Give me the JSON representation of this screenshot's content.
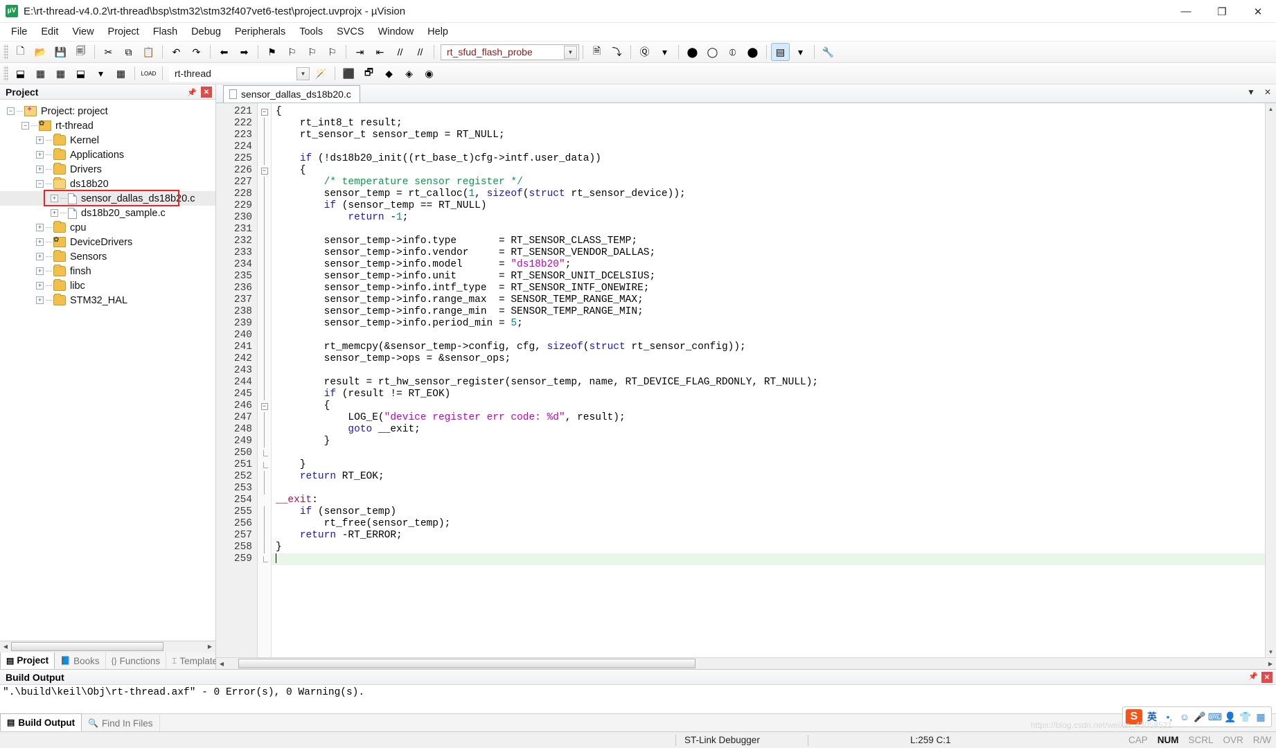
{
  "window": {
    "title": "E:\\rt-thread-v4.0.2\\rt-thread\\bsp\\stm32\\stm32f407vet6-test\\project.uvprojx - µVision",
    "app_icon": "uvision-icon",
    "minimize": "—",
    "maximize": "❐",
    "close": "✕"
  },
  "menubar": [
    {
      "label": "File"
    },
    {
      "label": "Edit"
    },
    {
      "label": "View"
    },
    {
      "label": "Project"
    },
    {
      "label": "Flash"
    },
    {
      "label": "Debug"
    },
    {
      "label": "Peripherals"
    },
    {
      "label": "Tools"
    },
    {
      "label": "SVCS"
    },
    {
      "label": "Window"
    },
    {
      "label": "Help"
    }
  ],
  "toolbar_main": {
    "buttons": [
      {
        "name": "new-file-button",
        "glyph": "🗋"
      },
      {
        "name": "open-file-button",
        "glyph": "📂"
      },
      {
        "name": "save-button",
        "glyph": "💾"
      },
      {
        "name": "save-all-button",
        "glyph": "🗐"
      },
      {
        "name": "cut-button",
        "glyph": "✂"
      },
      {
        "name": "copy-button",
        "glyph": "⧉"
      },
      {
        "name": "paste-button",
        "glyph": "📋"
      },
      {
        "name": "undo-button",
        "glyph": "↶"
      },
      {
        "name": "redo-button",
        "glyph": "↷"
      },
      {
        "name": "navigate-back-button",
        "glyph": "⬅"
      },
      {
        "name": "navigate-forward-button",
        "glyph": "➡"
      },
      {
        "name": "bookmark-toggle-button",
        "glyph": "⚑"
      },
      {
        "name": "bookmark-prev-button",
        "glyph": "⚐"
      },
      {
        "name": "bookmark-next-button",
        "glyph": "⚐"
      },
      {
        "name": "bookmark-clear-button",
        "glyph": "⚐"
      },
      {
        "name": "indent-button",
        "glyph": "⇥"
      },
      {
        "name": "outdent-button",
        "glyph": "⇤"
      },
      {
        "name": "comment-button",
        "glyph": "//"
      },
      {
        "name": "uncomment-button",
        "glyph": "//"
      }
    ],
    "find_combo": {
      "value": "rt_sfud_flash_probe",
      "arrow": "▼"
    },
    "after_find": [
      {
        "name": "find-in-files-button",
        "glyph": "🗎"
      },
      {
        "name": "goto-definition-button",
        "glyph": "⤵"
      },
      {
        "name": "debug-start-button",
        "glyph": "Ⓠ"
      },
      {
        "name": "debug-dropdown-arrow",
        "glyph": "▾"
      },
      {
        "name": "insert-breakpoint-button",
        "glyph": "⬤"
      },
      {
        "name": "disable-breakpoint-button",
        "glyph": "◯"
      },
      {
        "name": "disable-all-breakpoints-button",
        "glyph": "⦶"
      },
      {
        "name": "kill-all-breakpoints-button",
        "glyph": "⬤"
      },
      {
        "name": "project-window-toggle-button",
        "glyph": "▤"
      },
      {
        "name": "window-dropdown-arrow",
        "glyph": "▾"
      },
      {
        "name": "configure-button",
        "glyph": "🔧"
      }
    ]
  },
  "toolbar_build": {
    "buttons": [
      {
        "name": "translate-file-button",
        "glyph": "⬓"
      },
      {
        "name": "build-target-button",
        "glyph": "▦"
      },
      {
        "name": "rebuild-all-button",
        "glyph": "▦"
      },
      {
        "name": "batch-build-button",
        "glyph": "⬓"
      },
      {
        "name": "batch-build-arrow",
        "glyph": "▾"
      },
      {
        "name": "stop-build-button",
        "glyph": "▦"
      },
      {
        "name": "download-button",
        "glyph": "LOAD"
      }
    ],
    "target_combo": {
      "value": "rt-thread",
      "arrow": "▼"
    },
    "after_target": [
      {
        "name": "target-options-button",
        "glyph": "🪄"
      },
      {
        "name": "manage-components-button",
        "glyph": "⬛"
      },
      {
        "name": "multi-project-button",
        "glyph": "🗗"
      },
      {
        "name": "pack-installer-button",
        "glyph": "◆"
      },
      {
        "name": "manage-run-time-button",
        "glyph": "◈"
      },
      {
        "name": "svcs-button",
        "glyph": "◉"
      }
    ]
  },
  "project_panel": {
    "title": "Project",
    "pin_icon": "pin-icon",
    "close_icon": "close-icon",
    "tree": [
      {
        "label": "Project: project",
        "depth": 0,
        "expander": "−",
        "icon": "proj",
        "highlight": false
      },
      {
        "label": "rt-thread",
        "depth": 1,
        "expander": "−",
        "icon": "rt",
        "highlight": false
      },
      {
        "label": "Kernel",
        "depth": 2,
        "expander": "+",
        "icon": "folder",
        "highlight": false
      },
      {
        "label": "Applications",
        "depth": 2,
        "expander": "+",
        "icon": "folder",
        "highlight": false
      },
      {
        "label": "Drivers",
        "depth": 2,
        "expander": "+",
        "icon": "folder",
        "highlight": false
      },
      {
        "label": "ds18b20",
        "depth": 2,
        "expander": "−",
        "icon": "folder-open",
        "highlight": false
      },
      {
        "label": "sensor_dallas_ds18b20.c",
        "depth": 3,
        "expander": "+",
        "icon": "file",
        "highlight": true
      },
      {
        "label": "ds18b20_sample.c",
        "depth": 3,
        "expander": "+",
        "icon": "file",
        "highlight": false
      },
      {
        "label": "cpu",
        "depth": 2,
        "expander": "+",
        "icon": "folder",
        "highlight": false
      },
      {
        "label": "DeviceDrivers",
        "depth": 2,
        "expander": "+",
        "icon": "rt",
        "highlight": false
      },
      {
        "label": "Sensors",
        "depth": 2,
        "expander": "+",
        "icon": "folder",
        "highlight": false
      },
      {
        "label": "finsh",
        "depth": 2,
        "expander": "+",
        "icon": "folder",
        "highlight": false
      },
      {
        "label": "libc",
        "depth": 2,
        "expander": "+",
        "icon": "folder",
        "highlight": false
      },
      {
        "label": "STM32_HAL",
        "depth": 2,
        "expander": "+",
        "icon": "folder",
        "highlight": false
      }
    ],
    "tabs": [
      {
        "label": "Project",
        "icon": "project-icon",
        "selected": true
      },
      {
        "label": "Books",
        "icon": "books-icon",
        "selected": false
      },
      {
        "label": "Functions",
        "icon": "functions-icon",
        "selected": false
      },
      {
        "label": "Templates",
        "icon": "templates-icon",
        "selected": false
      }
    ],
    "scroll_left_arrow": "◀",
    "scroll_right_arrow": "▶"
  },
  "editor": {
    "tab_label": "sensor_dallas_ds18b20.c",
    "tab_icon": "c-file-icon",
    "dropdown_icon": "▼",
    "close_icon": "✕",
    "first_line": 221,
    "lines": [
      {
        "n": 221,
        "fold": "minus",
        "tokens": [
          {
            "t": "{",
            "c": ""
          }
        ]
      },
      {
        "n": 222,
        "fold": "bar",
        "tokens": [
          {
            "t": "    rt_int8_t result;",
            "c": ""
          }
        ]
      },
      {
        "n": 223,
        "fold": "bar",
        "tokens": [
          {
            "t": "    rt_sensor_t sensor_temp = RT_NULL;",
            "c": ""
          }
        ]
      },
      {
        "n": 224,
        "fold": "bar",
        "tokens": [
          {
            "t": "",
            "c": ""
          }
        ]
      },
      {
        "n": 225,
        "fold": "bar",
        "tokens": [
          {
            "t": "    ",
            "c": ""
          },
          {
            "t": "if",
            "c": "kw"
          },
          {
            "t": " (!ds18b20_init((rt_base_t)cfg->intf.user_data))",
            "c": ""
          }
        ]
      },
      {
        "n": 226,
        "fold": "minus",
        "tokens": [
          {
            "t": "    {",
            "c": ""
          }
        ]
      },
      {
        "n": 227,
        "fold": "bar",
        "tokens": [
          {
            "t": "        ",
            "c": ""
          },
          {
            "t": "/* temperature sensor register */",
            "c": "cmt"
          }
        ]
      },
      {
        "n": 228,
        "fold": "bar",
        "tokens": [
          {
            "t": "        sensor_temp = rt_calloc(",
            "c": ""
          },
          {
            "t": "1",
            "c": "num"
          },
          {
            "t": ", ",
            "c": ""
          },
          {
            "t": "sizeof",
            "c": "kw"
          },
          {
            "t": "(",
            "c": ""
          },
          {
            "t": "struct",
            "c": "kw"
          },
          {
            "t": " rt_sensor_device));",
            "c": ""
          }
        ]
      },
      {
        "n": 229,
        "fold": "bar",
        "tokens": [
          {
            "t": "        ",
            "c": ""
          },
          {
            "t": "if",
            "c": "kw"
          },
          {
            "t": " (sensor_temp == RT_NULL)",
            "c": ""
          }
        ]
      },
      {
        "n": 230,
        "fold": "bar",
        "tokens": [
          {
            "t": "            ",
            "c": ""
          },
          {
            "t": "return",
            "c": "kw"
          },
          {
            "t": " -",
            "c": ""
          },
          {
            "t": "1",
            "c": "num"
          },
          {
            "t": ";",
            "c": ""
          }
        ]
      },
      {
        "n": 231,
        "fold": "bar",
        "tokens": [
          {
            "t": "",
            "c": ""
          }
        ]
      },
      {
        "n": 232,
        "fold": "bar",
        "tokens": [
          {
            "t": "        sensor_temp->info.type       = RT_SENSOR_CLASS_TEMP;",
            "c": ""
          }
        ]
      },
      {
        "n": 233,
        "fold": "bar",
        "tokens": [
          {
            "t": "        sensor_temp->info.vendor     = RT_SENSOR_VENDOR_DALLAS;",
            "c": ""
          }
        ]
      },
      {
        "n": 234,
        "fold": "bar",
        "tokens": [
          {
            "t": "        sensor_temp->info.model      = ",
            "c": ""
          },
          {
            "t": "\"ds18b20\"",
            "c": "str"
          },
          {
            "t": ";",
            "c": ""
          }
        ]
      },
      {
        "n": 235,
        "fold": "bar",
        "tokens": [
          {
            "t": "        sensor_temp->info.unit       = RT_SENSOR_UNIT_DCELSIUS;",
            "c": ""
          }
        ]
      },
      {
        "n": 236,
        "fold": "bar",
        "tokens": [
          {
            "t": "        sensor_temp->info.intf_type  = RT_SENSOR_INTF_ONEWIRE;",
            "c": ""
          }
        ]
      },
      {
        "n": 237,
        "fold": "bar",
        "tokens": [
          {
            "t": "        sensor_temp->info.range_max  = SENSOR_TEMP_RANGE_MAX;",
            "c": ""
          }
        ]
      },
      {
        "n": 238,
        "fold": "bar",
        "tokens": [
          {
            "t": "        sensor_temp->info.range_min  = SENSOR_TEMP_RANGE_MIN;",
            "c": ""
          }
        ]
      },
      {
        "n": 239,
        "fold": "bar",
        "tokens": [
          {
            "t": "        sensor_temp->info.period_min = ",
            "c": ""
          },
          {
            "t": "5",
            "c": "num"
          },
          {
            "t": ";",
            "c": ""
          }
        ]
      },
      {
        "n": 240,
        "fold": "bar",
        "tokens": [
          {
            "t": "",
            "c": ""
          }
        ]
      },
      {
        "n": 241,
        "fold": "bar",
        "tokens": [
          {
            "t": "        rt_memcpy(&sensor_temp->config, cfg, ",
            "c": ""
          },
          {
            "t": "sizeof",
            "c": "kw"
          },
          {
            "t": "(",
            "c": ""
          },
          {
            "t": "struct",
            "c": "kw"
          },
          {
            "t": " rt_sensor_config));",
            "c": ""
          }
        ]
      },
      {
        "n": 242,
        "fold": "bar",
        "tokens": [
          {
            "t": "        sensor_temp->ops = &sensor_ops;",
            "c": ""
          }
        ]
      },
      {
        "n": 243,
        "fold": "bar",
        "tokens": [
          {
            "t": "",
            "c": ""
          }
        ]
      },
      {
        "n": 244,
        "fold": "bar",
        "tokens": [
          {
            "t": "        result = rt_hw_sensor_register(sensor_temp, name, RT_DEVICE_FLAG_RDONLY, RT_NULL);",
            "c": ""
          }
        ]
      },
      {
        "n": 245,
        "fold": "bar",
        "tokens": [
          {
            "t": "        ",
            "c": ""
          },
          {
            "t": "if",
            "c": "kw"
          },
          {
            "t": " (result != RT_EOK)",
            "c": ""
          }
        ]
      },
      {
        "n": 246,
        "fold": "minus",
        "tokens": [
          {
            "t": "        {",
            "c": ""
          }
        ]
      },
      {
        "n": 247,
        "fold": "bar",
        "tokens": [
          {
            "t": "            LOG_E(",
            "c": ""
          },
          {
            "t": "\"device register err code: %d\"",
            "c": "str"
          },
          {
            "t": ", result);",
            "c": ""
          }
        ]
      },
      {
        "n": 248,
        "fold": "bar",
        "tokens": [
          {
            "t": "            ",
            "c": ""
          },
          {
            "t": "goto",
            "c": "kw"
          },
          {
            "t": " __exit;",
            "c": ""
          }
        ]
      },
      {
        "n": 249,
        "fold": "bar",
        "tokens": [
          {
            "t": "        }",
            "c": ""
          }
        ]
      },
      {
        "n": 250,
        "fold": "end",
        "tokens": [
          {
            "t": "",
            "c": ""
          }
        ]
      },
      {
        "n": 251,
        "fold": "end",
        "tokens": [
          {
            "t": "    }",
            "c": ""
          }
        ]
      },
      {
        "n": 252,
        "fold": "bar",
        "tokens": [
          {
            "t": "    ",
            "c": ""
          },
          {
            "t": "return",
            "c": "kw"
          },
          {
            "t": " RT_EOK;",
            "c": ""
          }
        ]
      },
      {
        "n": 253,
        "fold": "bar",
        "tokens": [
          {
            "t": "",
            "c": ""
          }
        ]
      },
      {
        "n": 254,
        "fold": "none",
        "tokens": [
          {
            "t": "__exit",
            "c": "lbl"
          },
          {
            "t": ":",
            "c": ""
          }
        ]
      },
      {
        "n": 255,
        "fold": "bar",
        "tokens": [
          {
            "t": "    ",
            "c": ""
          },
          {
            "t": "if",
            "c": "kw"
          },
          {
            "t": " (sensor_temp)",
            "c": ""
          }
        ]
      },
      {
        "n": 256,
        "fold": "bar",
        "tokens": [
          {
            "t": "        rt_free(sensor_temp);",
            "c": ""
          }
        ]
      },
      {
        "n": 257,
        "fold": "bar",
        "tokens": [
          {
            "t": "    ",
            "c": ""
          },
          {
            "t": "return",
            "c": "kw"
          },
          {
            "t": " -RT_ERROR;",
            "c": ""
          }
        ]
      },
      {
        "n": 258,
        "fold": "bar",
        "tokens": [
          {
            "t": "}",
            "c": ""
          }
        ]
      },
      {
        "n": 259,
        "fold": "end",
        "tokens": [
          {
            "t": "",
            "c": ""
          }
        ],
        "current": true
      }
    ],
    "scroll_up_arrow": "▲",
    "scroll_down_arrow": "▼",
    "scroll_left_arrow": "◀",
    "scroll_right_arrow": "▶"
  },
  "build_output": {
    "title": "Build Output",
    "pin_icon": "pin-icon",
    "close_icon": "close-icon",
    "text": "\".\\build\\keil\\Obj\\rt-thread.axf\" - 0 Error(s), 0 Warning(s).",
    "tabs": [
      {
        "label": "Build Output",
        "icon": "build-output-icon",
        "selected": true
      },
      {
        "label": "Find In Files",
        "icon": "find-in-files-icon",
        "selected": false
      }
    ]
  },
  "ime": {
    "logo": "S",
    "mode": "英",
    "items": [
      {
        "name": "punctuation-icon",
        "glyph": "•,"
      },
      {
        "name": "emoji-icon",
        "glyph": "☺"
      },
      {
        "name": "microphone-icon",
        "glyph": "🎤"
      },
      {
        "name": "keyboard-icon",
        "glyph": "⌨"
      },
      {
        "name": "user-icon",
        "glyph": "👤"
      },
      {
        "name": "skin-icon",
        "glyph": "👕"
      },
      {
        "name": "toolbox-icon",
        "glyph": "▦"
      }
    ]
  },
  "statusbar": {
    "debugger": "ST-Link Debugger",
    "position": "L:259 C:1",
    "flags": [
      {
        "label": "CAP",
        "on": false
      },
      {
        "label": "NUM",
        "on": true
      },
      {
        "label": "SCRL",
        "on": false
      },
      {
        "label": "OVR",
        "on": false
      },
      {
        "label": "R/W",
        "on": false
      }
    ]
  },
  "watermark": "https://blog.csdn.net/weixin_43058521"
}
